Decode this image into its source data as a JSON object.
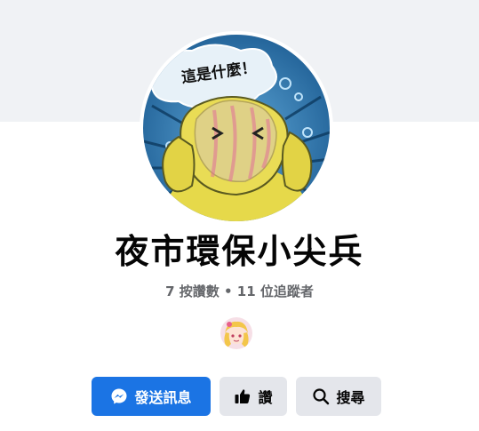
{
  "page": {
    "title": "夜市環保小尖兵",
    "likes_text": "7 按讚數",
    "separator": " • ",
    "followers_text": "11 位追蹤者"
  },
  "avatar": {
    "speech_text": "這是什麼！",
    "icon": "comic-character-avatar"
  },
  "actions": {
    "message_label": "發送訊息",
    "like_label": "讚",
    "search_label": "搜尋"
  },
  "colors": {
    "primary": "#1b74e4",
    "secondary_bg": "#e4e6eb",
    "cover_bg": "#f0f2f5",
    "text": "#050505",
    "muted_text": "#65676b"
  }
}
